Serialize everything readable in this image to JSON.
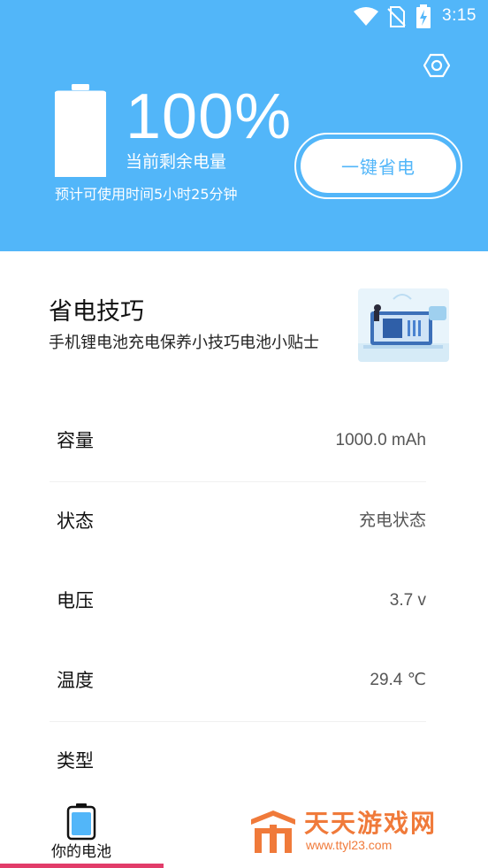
{
  "status_bar": {
    "time": "3:15"
  },
  "colors": {
    "header_bg": "#52b6f9",
    "accent": "#52b6f9",
    "nav_indicator": "#e23c6a",
    "watermark": "#f07a3a"
  },
  "header": {
    "battery_level": 1.0,
    "percent_text": "100%",
    "remain_label": "当前剩余电量",
    "estimate_text": "预计可使用时间5小时25分钟",
    "save_button_label": "一键省电",
    "settings_icon": "gear-icon"
  },
  "tips": {
    "title": "省电技巧",
    "subtitle": "手机锂电池充电保养小技巧电池小贴士"
  },
  "info": {
    "rows": [
      {
        "label": "容量",
        "value": "1000.0 mAh"
      },
      {
        "label": "状态",
        "value": "充电状态"
      },
      {
        "label": "电压",
        "value": "3.7 v"
      },
      {
        "label": "温度",
        "value": "29.4 ℃"
      },
      {
        "label": "类型",
        "value": ""
      }
    ]
  },
  "bottom_nav": {
    "items": [
      {
        "label": "你的电池",
        "icon": "battery-icon",
        "active": true
      }
    ]
  },
  "watermark": {
    "title": "天天游戏网",
    "url": "www.ttyl23.com"
  }
}
